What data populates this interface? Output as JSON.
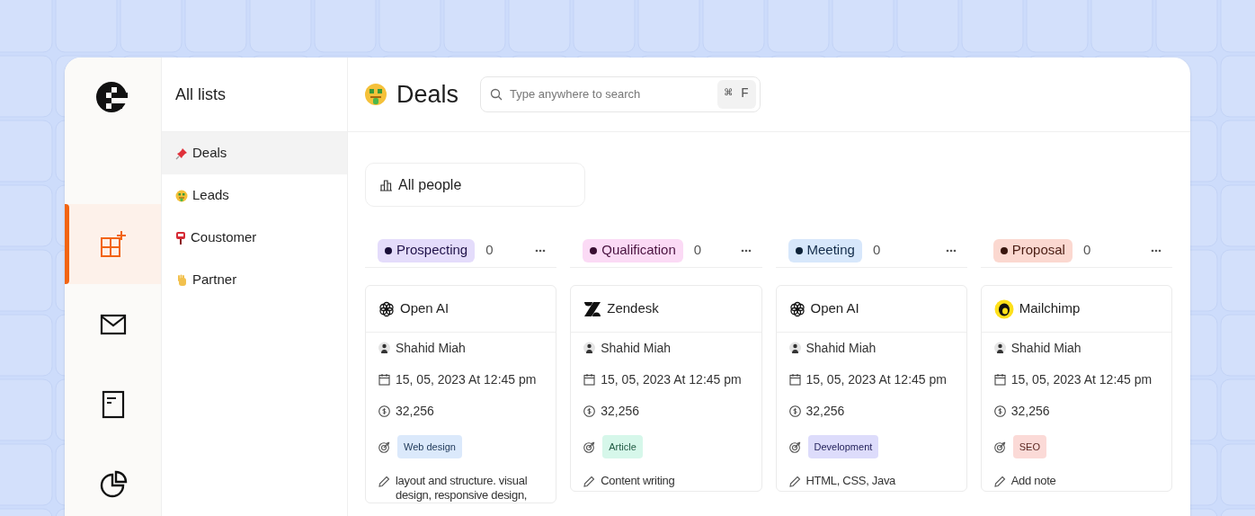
{
  "rail": {
    "items": [
      {
        "selected": true,
        "kind": "boards"
      },
      {
        "selected": false,
        "kind": "mail"
      },
      {
        "selected": false,
        "kind": "document"
      },
      {
        "selected": false,
        "kind": "chart"
      }
    ]
  },
  "lists": {
    "title": "All lists",
    "items": [
      {
        "label": "Deals",
        "selected": true
      },
      {
        "label": "Leads",
        "selected": false
      },
      {
        "label": "Coustomer",
        "selected": false
      },
      {
        "label": "Partner",
        "selected": false
      }
    ]
  },
  "page": {
    "title": "Deals"
  },
  "search": {
    "placeholder": "Type anywhere to search",
    "shortcut": "⌘ F"
  },
  "view": {
    "label": "All people"
  },
  "columns": [
    {
      "label": "Prospecting",
      "count": "0",
      "color": "#e4dcfb",
      "cards": [
        {
          "company": "Open AI",
          "owner": "Shahid Miah",
          "date": "15, 05, 2023 At 12:45 pm",
          "amount": "32,256",
          "tag": {
            "label": "Web design",
            "color": "#dbe9fb"
          },
          "note": "layout and structure. visual design, responsive design,"
        }
      ]
    },
    {
      "label": "Qualification",
      "count": "0",
      "color": "#fbdaf5",
      "cards": [
        {
          "company": "Zendesk",
          "owner": "Shahid Miah",
          "date": "15, 05, 2023 At 12:45 pm",
          "amount": "32,256",
          "tag": {
            "label": "Article",
            "color": "#d6f7ea"
          },
          "note": "Content writing"
        }
      ]
    },
    {
      "label": "Meeting",
      "count": "0",
      "color": "#d7e7fb",
      "cards": [
        {
          "company": "Open AI",
          "owner": "Shahid Miah",
          "date": "15, 05, 2023 At 12:45 pm",
          "amount": "32,256",
          "tag": {
            "label": "Development",
            "color": "#dddcfb"
          },
          "note": "HTML, CSS, Java"
        }
      ]
    },
    {
      "label": "Proposal",
      "count": "0",
      "color": "#fbd8d0",
      "cards": [
        {
          "company": "Mailchimp",
          "owner": "Shahid Miah",
          "date": "15, 05, 2023 At 12:45 pm",
          "amount": "32,256",
          "tag": {
            "label": "SEO",
            "color": "#fbdad7"
          },
          "note": "Add note"
        }
      ]
    }
  ]
}
